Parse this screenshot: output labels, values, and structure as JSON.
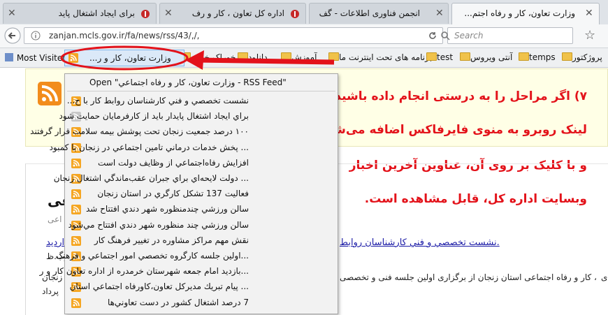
{
  "browser": {
    "tabs": [
      {
        "title": "برای ایجاد اشتغال پاید"
      },
      {
        "title": "اداره کل تعاون ، کار و رف"
      },
      {
        "title": "انجمن فناوری اطلاعات - گف"
      },
      {
        "title": "وزارت تعاون، کار و رفاه اجتم..."
      }
    ],
    "url": "zanjan.mcls.gov.ir/fa/news/rss/43/,/,",
    "search_placeholder": "Search"
  },
  "bookmarks": [
    {
      "label": "Most Visited"
    },
    {
      "label": "خوراک خبری"
    },
    {
      "label": "دانلود"
    },
    {
      "label": "آموزش"
    },
    {
      "label": "برنامه های تحت اینترنت ما"
    },
    {
      "label": "test"
    },
    {
      "label": "آنتی ویروس"
    },
    {
      "label": "temps"
    },
    {
      "label": "پروژکتور"
    }
  ],
  "live_bookmark": {
    "button_label": "وزارت تعاون، کار و ر...",
    "open_feed": "Open \"وزارت تعاون، کار و رفاه اجتماعي - RSS Feed\"",
    "items": [
      {
        "label": "نشست تخصصي و فني كارشناسان روابط كار با ح...",
        "icon": "rss-icon"
      },
      {
        "label": "براي ايجاد اشتغال پايدار بايد از كارفرمايان حمايت شود",
        "icon": "rss-icon-gray"
      },
      {
        "label": "۱۰۰ درصد جمعيت زنجان تحت پوشش بيمه سلامت قرار گرفتند",
        "icon": "rss-icon"
      },
      {
        "label": "... پخش خدمات درماني تامين اجتماعي در زنجان با كمبود",
        "icon": "rss-icon"
      },
      {
        "label": "افزايش رفاه‌اجتماعي از وظايف دولت است",
        "icon": "rss-icon"
      },
      {
        "label": "... دولت لايحه‌اي براي جبران عقب‌ماندگي اشتغال زنجان",
        "icon": "rss-icon"
      },
      {
        "label": "فعاليت 137 تشكل كارگري در استان زنجان",
        "icon": "rss-icon"
      },
      {
        "label": "سالن ورزشي چندمنظوره شهر دندي افتتاح شد",
        "icon": "rss-icon"
      },
      {
        "label": "سالن ورزشي چند منظوره شهر دندي افتتاح مي‌شود",
        "icon": "rss-icon"
      },
      {
        "label": "نقش مهم مراكز مشاوره در تغيير فرهنگ كار",
        "icon": "rss-icon"
      },
      {
        "label": "...اولين جلسه كارگروه تخصصي امور اجتماعي و فرهنگ",
        "icon": "rss-icon"
      },
      {
        "label": "...بازديد امام جمعه شهرستان خرمدره از اداره تعاون كار و ر",
        "icon": "rss-icon"
      },
      {
        "label": "... پيام تبريك مديركل تعاون،كاورفاه اجتماعي استان",
        "icon": "rss-icon"
      },
      {
        "label": "7 درصد اشتغال كشور در دست تعاوني‌ها",
        "icon": "rss-icon"
      }
    ]
  },
  "annotation": {
    "color": "#e3121a",
    "lines": [
      "۷) اگر مراحل را به درستی انجام داده باشید،",
      "لینک روبرو به منوی فایرفاکس اضافه می‌شود",
      "و با کلیک بر روی آن، عناوین آخرین اخبار",
      "وبسایت اداره کل، قابل مشاهده است."
    ]
  },
  "page": {
    "heading_fragment": "عی",
    "sub_fragment": "اعی",
    "link_text": ".نشست تخصصي و فني كارشناسان روابط",
    "link_fragment": "اردید",
    "small_fragment": "رب.ظ",
    "body_text": "، کار و رفاه اجتماعی استان زنجان از برگزاری اولین جلسه فنی و تخصصی",
    "body_left1": "زنجان",
    "body_left2": "پرداد",
    "body_right1": "ی"
  }
}
